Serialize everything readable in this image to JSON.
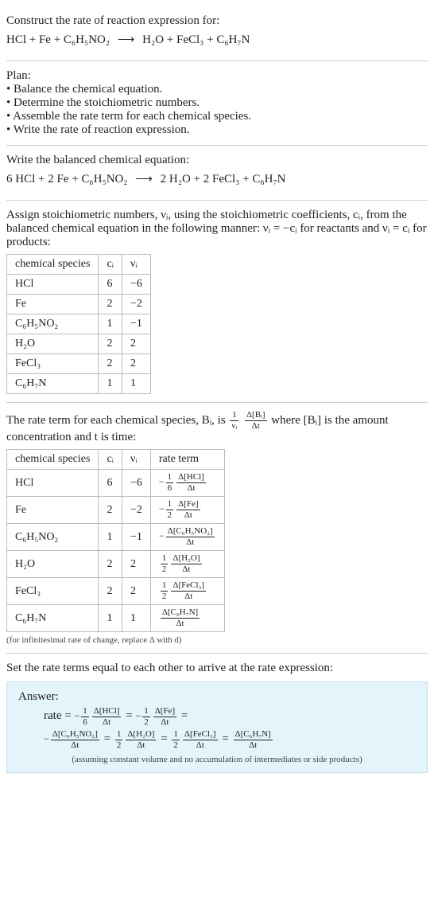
{
  "intro": {
    "heading": "Construct the rate of reaction expression for:",
    "reaction_lhs": "HCl + Fe + C₆H₅NO₂",
    "reaction_arrow": "⟶",
    "reaction_rhs": "H₂O + FeCl₃ + C₆H₇N"
  },
  "plan": {
    "heading": "Plan:",
    "items": [
      "• Balance the chemical equation.",
      "• Determine the stoichiometric numbers.",
      "• Assemble the rate term for each chemical species.",
      "• Write the rate of reaction expression."
    ]
  },
  "balanced": {
    "heading": "Write the balanced chemical equation:",
    "lhs": "6 HCl + 2 Fe + C₆H₅NO₂",
    "arrow": "⟶",
    "rhs": "2 H₂O + 2 FeCl₃ + C₆H₇N"
  },
  "stoich": {
    "intro1": "Assign stoichiometric numbers, νᵢ, using the stoichiometric coefficients, cᵢ, from the balanced chemical equation in the following manner: νᵢ = −cᵢ for reactants and νᵢ = cᵢ for products:",
    "headers": [
      "chemical species",
      "cᵢ",
      "νᵢ"
    ],
    "rows": [
      {
        "sp": "HCl",
        "c": "6",
        "v": "−6"
      },
      {
        "sp": "Fe",
        "c": "2",
        "v": "−2"
      },
      {
        "sp": "C₆H₅NO₂",
        "c": "1",
        "v": "−1"
      },
      {
        "sp": "H₂O",
        "c": "2",
        "v": "2"
      },
      {
        "sp": "FeCl₃",
        "c": "2",
        "v": "2"
      },
      {
        "sp": "C₆H₇N",
        "c": "1",
        "v": "1"
      }
    ]
  },
  "rateterms": {
    "intro_a": "The rate term for each chemical species, Bᵢ, is ",
    "intro_b": " where [Bᵢ] is the amount concentration and t is time:",
    "headers": [
      "chemical species",
      "cᵢ",
      "νᵢ",
      "rate term"
    ],
    "rows": [
      {
        "sp": "HCl",
        "c": "6",
        "v": "−6",
        "sign": "−",
        "coef_num": "1",
        "coef_den": "6",
        "d_num": "Δ[HCl]",
        "d_den": "Δt"
      },
      {
        "sp": "Fe",
        "c": "2",
        "v": "−2",
        "sign": "−",
        "coef_num": "1",
        "coef_den": "2",
        "d_num": "Δ[Fe]",
        "d_den": "Δt"
      },
      {
        "sp": "C₆H₅NO₂",
        "c": "1",
        "v": "−1",
        "sign": "−",
        "coef_num": "",
        "coef_den": "",
        "d_num": "Δ[C₆H₅NO₂]",
        "d_den": "Δt"
      },
      {
        "sp": "H₂O",
        "c": "2",
        "v": "2",
        "sign": "",
        "coef_num": "1",
        "coef_den": "2",
        "d_num": "Δ[H₂O]",
        "d_den": "Δt"
      },
      {
        "sp": "FeCl₃",
        "c": "2",
        "v": "2",
        "sign": "",
        "coef_num": "1",
        "coef_den": "2",
        "d_num": "Δ[FeCl₃]",
        "d_den": "Δt"
      },
      {
        "sp": "C₆H₇N",
        "c": "1",
        "v": "1",
        "sign": "",
        "coef_num": "",
        "coef_den": "",
        "d_num": "Δ[C₆H₇N]",
        "d_den": "Δt"
      }
    ],
    "footnote": "(for infinitesimal rate of change, replace Δ with d)"
  },
  "final": {
    "heading": "Set the rate terms equal to each other to arrive at the rate expression:",
    "answer_label": "Answer:",
    "rate_label": "rate =",
    "footnote": "(assuming constant volume and no accumulation of intermediates or side products)"
  },
  "chart_data": {
    "type": "table",
    "tables": [
      {
        "name": "stoichiometric numbers",
        "columns": [
          "chemical species",
          "c_i",
          "ν_i"
        ],
        "rows": [
          [
            "HCl",
            6,
            -6
          ],
          [
            "Fe",
            2,
            -2
          ],
          [
            "C6H5NO2",
            1,
            -1
          ],
          [
            "H2O",
            2,
            2
          ],
          [
            "FeCl3",
            2,
            2
          ],
          [
            "C6H7N",
            1,
            1
          ]
        ]
      },
      {
        "name": "rate terms",
        "columns": [
          "chemical species",
          "c_i",
          "ν_i",
          "rate term"
        ],
        "rows": [
          [
            "HCl",
            6,
            -6,
            "-(1/6) Δ[HCl]/Δt"
          ],
          [
            "Fe",
            2,
            -2,
            "-(1/2) Δ[Fe]/Δt"
          ],
          [
            "C6H5NO2",
            1,
            -1,
            "- Δ[C6H5NO2]/Δt"
          ],
          [
            "H2O",
            2,
            2,
            "(1/2) Δ[H2O]/Δt"
          ],
          [
            "FeCl3",
            2,
            2,
            "(1/2) Δ[FeCl3]/Δt"
          ],
          [
            "C6H7N",
            1,
            1,
            "Δ[C6H7N]/Δt"
          ]
        ]
      }
    ],
    "rate_expression": "rate = -(1/6) Δ[HCl]/Δt = -(1/2) Δ[Fe]/Δt = - Δ[C6H5NO2]/Δt = (1/2) Δ[H2O]/Δt = (1/2) Δ[FeCl3]/Δt = Δ[C6H7N]/Δt"
  }
}
